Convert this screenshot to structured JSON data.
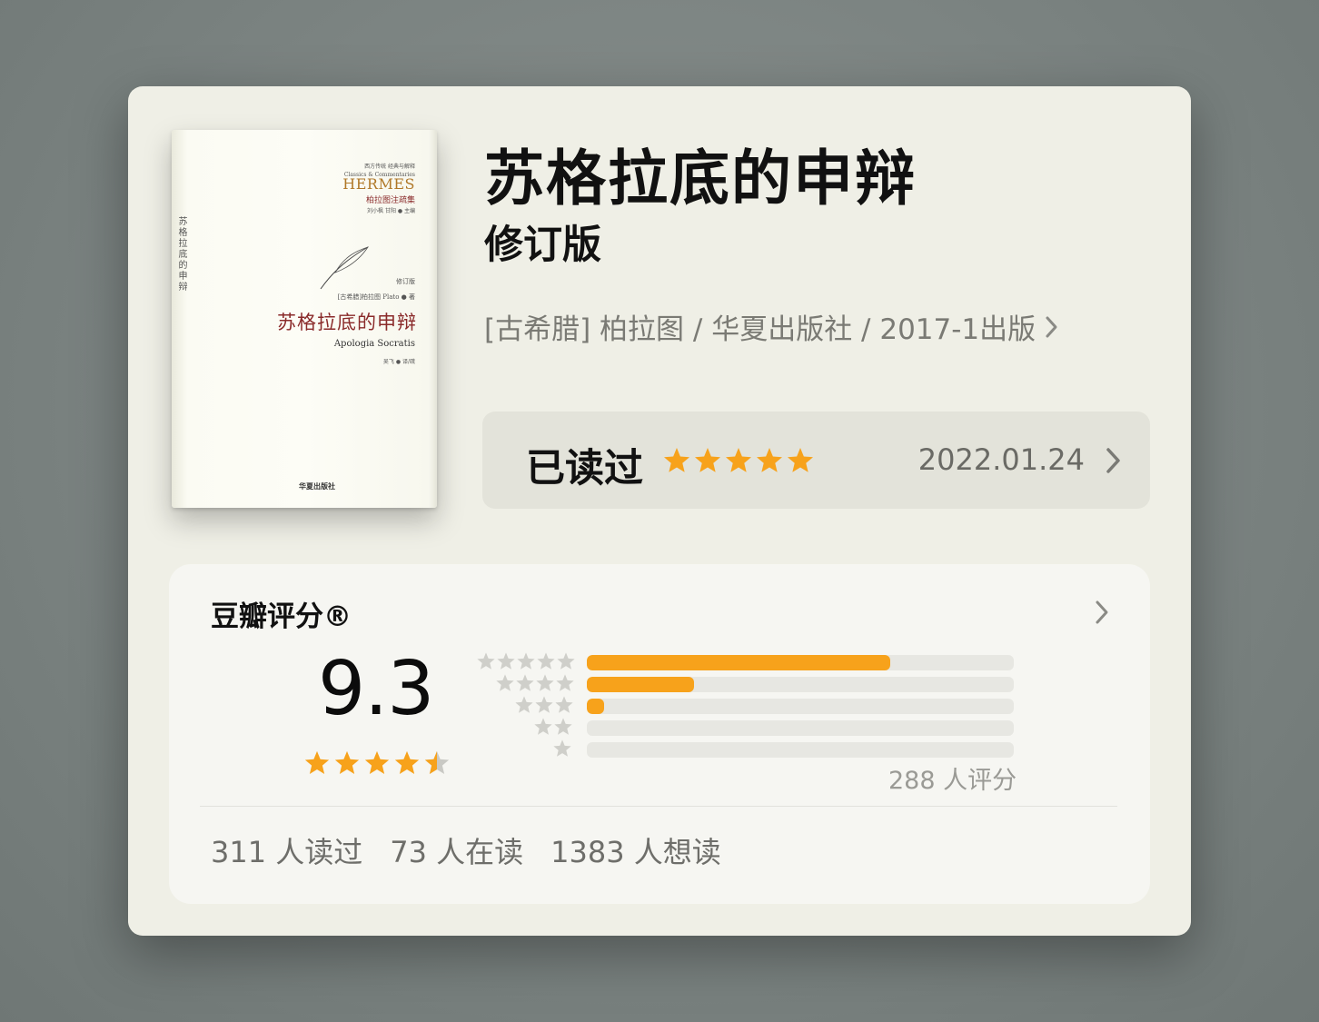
{
  "book": {
    "title": "苏格拉底的申辩",
    "subtitle": "修订版",
    "meta": "[古希腊] 柏拉图 / 华夏出版社 / 2017-1出版"
  },
  "cover": {
    "spine_text": "苏格拉底的申辩",
    "top_line_1": "西方传统 经典与解释",
    "top_line_2": "Classics & Commentaries",
    "brand": "HERMES",
    "series": "柏拉图注疏集",
    "editors": "刘小枫 甘阳 ● 主编",
    "edition": "修订版",
    "author": "[古希腊]柏拉图 Plato ● 著",
    "title": "苏格拉底的申辩",
    "latin_title": "Apologia Socratis",
    "translator": "吴飞 ● 译/疏",
    "publisher": "华夏出版社"
  },
  "read_status": {
    "label": "已读过",
    "user_rating": 5,
    "date": "2022.01.24"
  },
  "rating": {
    "title": "豆瓣评分®",
    "score": "9.3",
    "stars": 4.5,
    "distribution": [
      {
        "stars": 5,
        "fraction": 0.71
      },
      {
        "stars": 4,
        "fraction": 0.25
      },
      {
        "stars": 3,
        "fraction": 0.04
      },
      {
        "stars": 2,
        "fraction": 0.0
      },
      {
        "stars": 1,
        "fraction": 0.0
      }
    ],
    "count_label": "288 人评分"
  },
  "stats": {
    "read": "311 人读过",
    "reading": "73 人在读",
    "want": "1383 人想读"
  },
  "colors": {
    "accent": "#f7a21b",
    "card_bg": "#efefe6",
    "panel_bg": "#f6f6f2"
  }
}
